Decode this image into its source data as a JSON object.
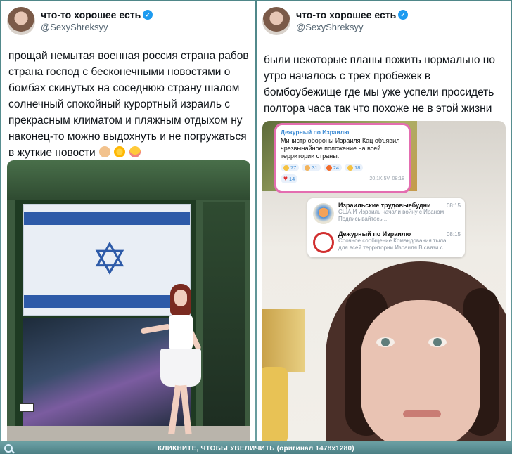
{
  "left_tweet": {
    "display_name": "что-то хорошее есть",
    "handle": "@SexyShreksyy",
    "text": "прощай немытая военная россия страна рабов страна господ с бесконечными новостями о бомбах скинутых на соседнюю страну шалом солнечный спокойный курортный израиль с прекрасным климатом и пляжным отдыхом ну наконец-то можно выдохнуть и не погружаться в жуткие новости",
    "emojis": [
      "folded-hands",
      "sun",
      "smiling-hearts"
    ]
  },
  "right_tweet": {
    "display_name": "что-то хорошее есть",
    "handle": "@SexyShreksyy",
    "text": "были некоторые планы пожить нормально но утро началось с трех пробежек в бомбоубежище где мы уже успели просидеть полтора часа так что похоже не в этой жизни"
  },
  "telegram_post": {
    "channel": "Дежурный по Израилю",
    "body": "Министр обороны Израиля Кац объявил чрезвычайное положение на всей территории страны.",
    "reactions": [
      {
        "icon": "scream",
        "count": "77"
      },
      {
        "icon": "thumbs-up",
        "count": "31"
      },
      {
        "icon": "fire",
        "count": "24"
      },
      {
        "icon": "cry",
        "count": "18"
      }
    ],
    "heart_count": "14",
    "views": "20,1K 5V, 08:18"
  },
  "chat_list": [
    {
      "name": "Израильские трудовыебудни",
      "time": "08:15",
      "preview": "США И Израиль начали войну с Ираном",
      "preview2": "Подписывайтесь..."
    },
    {
      "name": "Дежурный по Израилю",
      "time": "08:15",
      "preview": "Срочное сообщение Командования тыла",
      "preview2": "для всей территории Израиля В связи с ..."
    }
  ],
  "footer": {
    "text": "КЛИКНИТЕ, ЧТОБЫ УВЕЛИЧИТЬ (оригинал 1478x1280)"
  }
}
